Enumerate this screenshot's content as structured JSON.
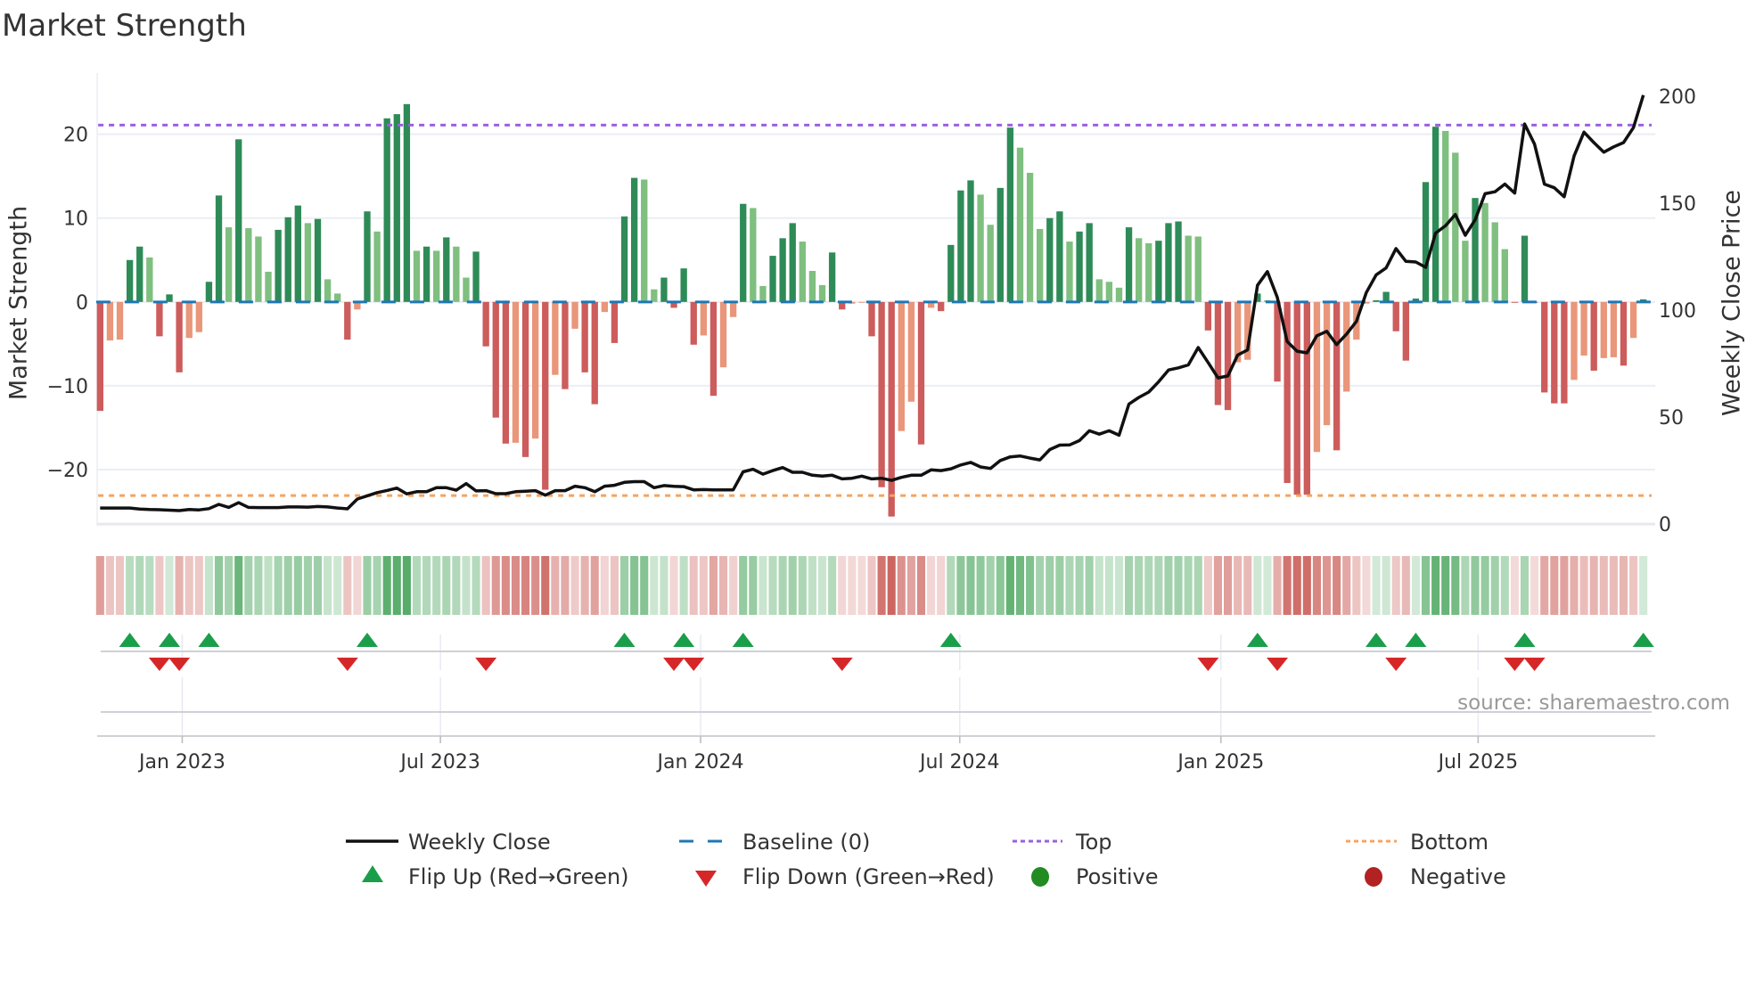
{
  "title": "Market Strength",
  "source": "source: sharemaestro.com",
  "colors": {
    "rise_pos": "#2e8b57",
    "fall_pos": "#7fbf7f",
    "fall_neg": "#cd5c5c",
    "rise_neg": "#e9967a",
    "strip_pos": "#3a9e4f",
    "strip_neg": "#c8554f",
    "baseline": "#1f77b4",
    "top": "#9c5fe0",
    "bottom": "#f4a460",
    "price": "#111111",
    "flip_up": "#1a9e4a",
    "flip_down": "#d62728",
    "positive": "#228b22",
    "negative": "#b22222"
  },
  "chart_data": {
    "type": "bar",
    "title": "Market Strength",
    "ylabel": "Market Strength",
    "y2label": "Weekly Close Price",
    "ylim": [
      -26.7,
      27.3
    ],
    "y2lim": [
      -0.8,
      210.8
    ],
    "yticks": [
      -20,
      -10,
      0,
      10,
      20
    ],
    "ytick_labels": [
      "−20",
      "−10",
      "0",
      "10",
      "20"
    ],
    "y2ticks": [
      0,
      50,
      100,
      150,
      200
    ],
    "y2tick_labels": [
      "0",
      "50",
      "100",
      "150",
      "200"
    ],
    "x_unit": "week index",
    "xlim": [
      -0.3,
      157.2
    ],
    "xticks": [
      8.3,
      34.4,
      60.7,
      86.9,
      113.3,
      139.3
    ],
    "xtick_labels": [
      "Jan 2023",
      "Jul 2023",
      "Jan 2024",
      "Jul 2024",
      "Jan 2025",
      "Jul 2025"
    ],
    "top_level": 21.1,
    "bottom_level": -23.1,
    "baseline": 0,
    "strength": [
      -13,
      -4.6,
      -4.5,
      5.0,
      6.6,
      5.3,
      -4.1,
      0.9,
      -8.4,
      -4.3,
      -3.6,
      2.4,
      12.7,
      8.9,
      19.4,
      8.8,
      7.8,
      3.6,
      8.6,
      10.1,
      11.5,
      9.4,
      9.9,
      2.7,
      1.0,
      -4.5,
      -0.9,
      10.8,
      8.4,
      21.9,
      22.4,
      23.6,
      6.1,
      6.6,
      6.1,
      7.7,
      6.6,
      2.9,
      6.0,
      -5.3,
      -13.8,
      -16.9,
      -16.8,
      -18.5,
      -16.3,
      -22.4,
      -8.7,
      -10.4,
      -3.2,
      -8.4,
      -12.2,
      -1.2,
      -4.9,
      10.2,
      14.8,
      14.6,
      1.5,
      2.9,
      -0.7,
      4.0,
      -5.1,
      -4.0,
      -11.2,
      -7.8,
      -1.8,
      11.7,
      11.2,
      1.9,
      5.5,
      7.6,
      9.4,
      7.2,
      3.7,
      2.0,
      5.9,
      -0.9,
      -0.2,
      -0.1,
      -4.1,
      -22.1,
      -25.6,
      -15.4,
      -11.9,
      -17.0,
      -0.7,
      -1.1,
      6.8,
      13.3,
      14.5,
      12.8,
      9.2,
      13.6,
      20.8,
      18.4,
      15.4,
      8.7,
      10.0,
      10.8,
      7.2,
      8.4,
      9.4,
      2.7,
      2.4,
      1.7,
      8.9,
      7.6,
      7.0,
      7.3,
      9.4,
      9.6,
      7.9,
      7.8,
      -3.4,
      -12.3,
      -12.9,
      -7.2,
      -6.9,
      1.0,
      0.2,
      -9.5,
      -21.6,
      -23.0,
      -23.0,
      -17.9,
      -14.7,
      -17.7,
      -10.7,
      -4.5,
      -0.2,
      0.2,
      1.2,
      -3.5,
      -7.0,
      0.4,
      14.3,
      20.9,
      20.4,
      17.8,
      7.3,
      12.4,
      11.8,
      9.5,
      6.3,
      -0.1,
      7.9,
      -0.1,
      -10.8,
      -12.1,
      -12.1,
      -9.3,
      -6.4,
      -8.2,
      -6.7,
      -6.6,
      -7.6,
      -4.3,
      0.3
    ],
    "weekly_close": [
      7.5,
      7.5,
      7.5,
      7.5,
      7,
      6.8,
      6.7,
      6.5,
      6.3,
      6.8,
      6.6,
      7.2,
      9.2,
      7.8,
      10,
      7.8,
      7.7,
      7.7,
      7.7,
      8,
      8,
      7.9,
      8.2,
      8,
      7.5,
      7.1,
      11.7,
      13.2,
      14.7,
      15.7,
      16.8,
      14.1,
      15.1,
      15.1,
      17,
      17,
      15.8,
      18.9,
      15.5,
      15.6,
      14.2,
      14.2,
      15.1,
      15.3,
      15.6,
      13.5,
      15.6,
      15.6,
      17.7,
      17,
      15.1,
      17.7,
      18.1,
      19.5,
      19.8,
      19.8,
      17,
      18,
      17.6,
      17.5,
      16,
      16.1,
      16,
      16,
      16,
      24.4,
      25.6,
      23.3,
      25,
      26.4,
      24.2,
      24.2,
      22.8,
      22.4,
      22.8,
      21.1,
      21.4,
      22.4,
      21.1,
      21.4,
      20.4,
      21.8,
      22.8,
      22.8,
      25.3,
      25,
      25.8,
      27.6,
      28.8,
      26.7,
      26,
      29.7,
      31.4,
      31.8,
      30.8,
      30,
      34.8,
      36.9,
      37,
      39,
      43.6,
      42,
      43.6,
      41.5,
      56.1,
      59.2,
      61.7,
      66.5,
      72,
      73,
      74.4,
      82.5,
      75.5,
      68.3,
      69.2,
      79,
      81.4,
      111.6,
      118,
      106,
      85.3,
      80.8,
      80,
      88,
      90.1,
      83.9,
      88.8,
      94.7,
      108.2,
      116.5,
      119.7,
      128.8,
      122.8,
      122.5,
      120,
      136,
      139.4,
      144.7,
      135,
      142.2,
      154.4,
      155.3,
      158.9,
      154.7,
      187,
      177.6,
      158.9,
      157.2,
      153,
      172,
      183.2,
      178.3,
      173.8,
      176.3,
      178.3,
      185.3,
      200.5
    ],
    "flip_up_weeks": [
      3,
      7,
      11,
      27,
      53,
      59,
      65,
      86,
      117,
      129,
      133,
      144,
      156
    ],
    "flip_down_weeks": [
      6,
      8,
      25,
      39,
      58,
      60,
      75,
      112,
      119,
      131,
      143,
      145
    ],
    "legend": {
      "placement": "bottom",
      "items": [
        {
          "label": "Weekly Close"
        },
        {
          "label": "Baseline (0)"
        },
        {
          "label": "Top"
        },
        {
          "label": "Bottom"
        },
        {
          "label": "Flip Up (Red→Green)"
        },
        {
          "label": "Flip Down (Green→Red)"
        },
        {
          "label": "Positive"
        },
        {
          "label": "Negative"
        }
      ]
    }
  }
}
